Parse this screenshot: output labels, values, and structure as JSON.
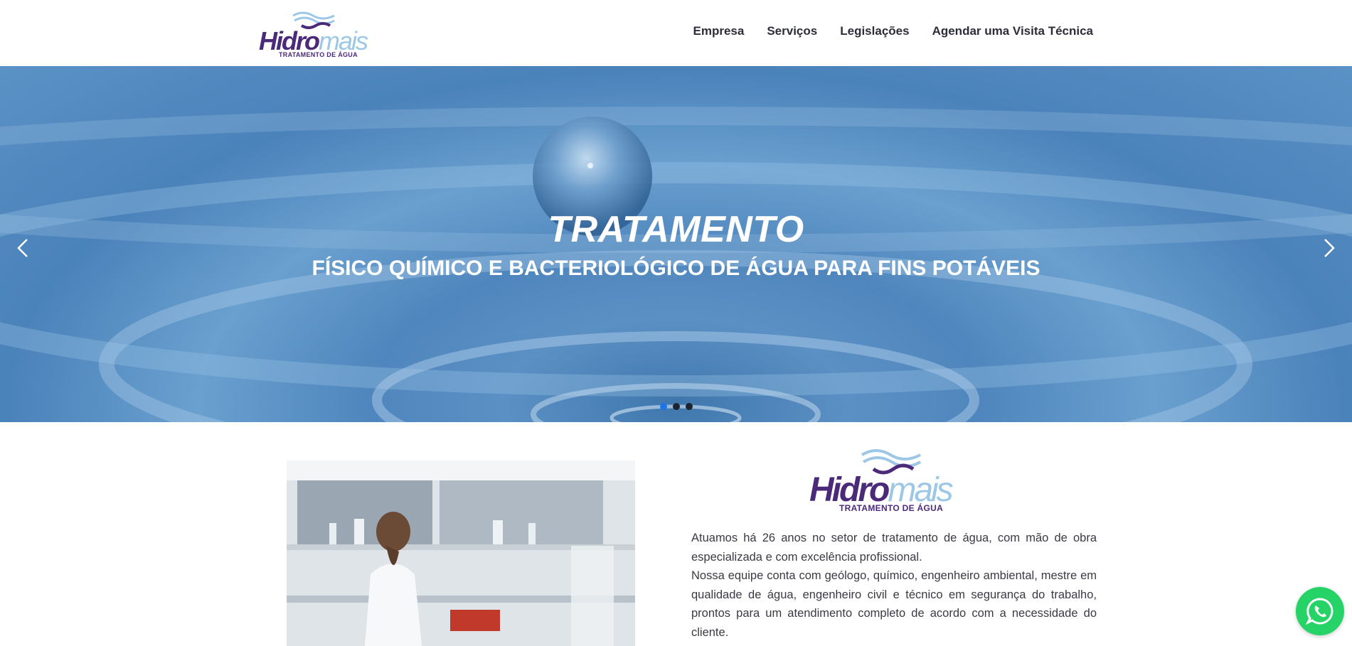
{
  "header": {
    "logo": {
      "word1": "Hidro",
      "word2": "mais",
      "tagline": "TRATAMENTO DE ÁGUA"
    },
    "nav": [
      {
        "label": "Empresa"
      },
      {
        "label": "Serviços"
      },
      {
        "label": "Legislações"
      },
      {
        "label": "Agendar uma Visita Técnica"
      }
    ]
  },
  "hero": {
    "title": "TRATAMENTO",
    "subtitle": "FÍSICO QUÍMICO E BACTERIOLÓGICO DE ÁGUA PARA FINS POTÁVEIS",
    "prev_icon": "chevron-left-icon",
    "next_icon": "chevron-right-icon",
    "slides_count": 3,
    "active_slide": 1
  },
  "about": {
    "logo": {
      "word1": "Hidro",
      "word2": "mais",
      "tagline": "TRATAMENTO DE ÁGUA"
    },
    "paragraph1": "Atuamos há 26 anos no setor de tratamento de água, com mão de obra especializada e com excelência profissional.",
    "paragraph2": "Nossa equipe conta com geólogo, químico, engenheiro ambiental, mestre em qualidade de água, engenheiro civil e técnico em segurança do trabalho, prontos para um atendimento completo de acordo com a necessidade do cliente."
  },
  "whatsapp": {
    "icon": "whatsapp-icon"
  },
  "colors": {
    "brand_purple": "#4b2a7a",
    "brand_light_blue": "#9cc7e6",
    "hero_blue": "#5b90c4",
    "dot_active": "#1e73e8",
    "whatsapp_green": "#25d366"
  }
}
